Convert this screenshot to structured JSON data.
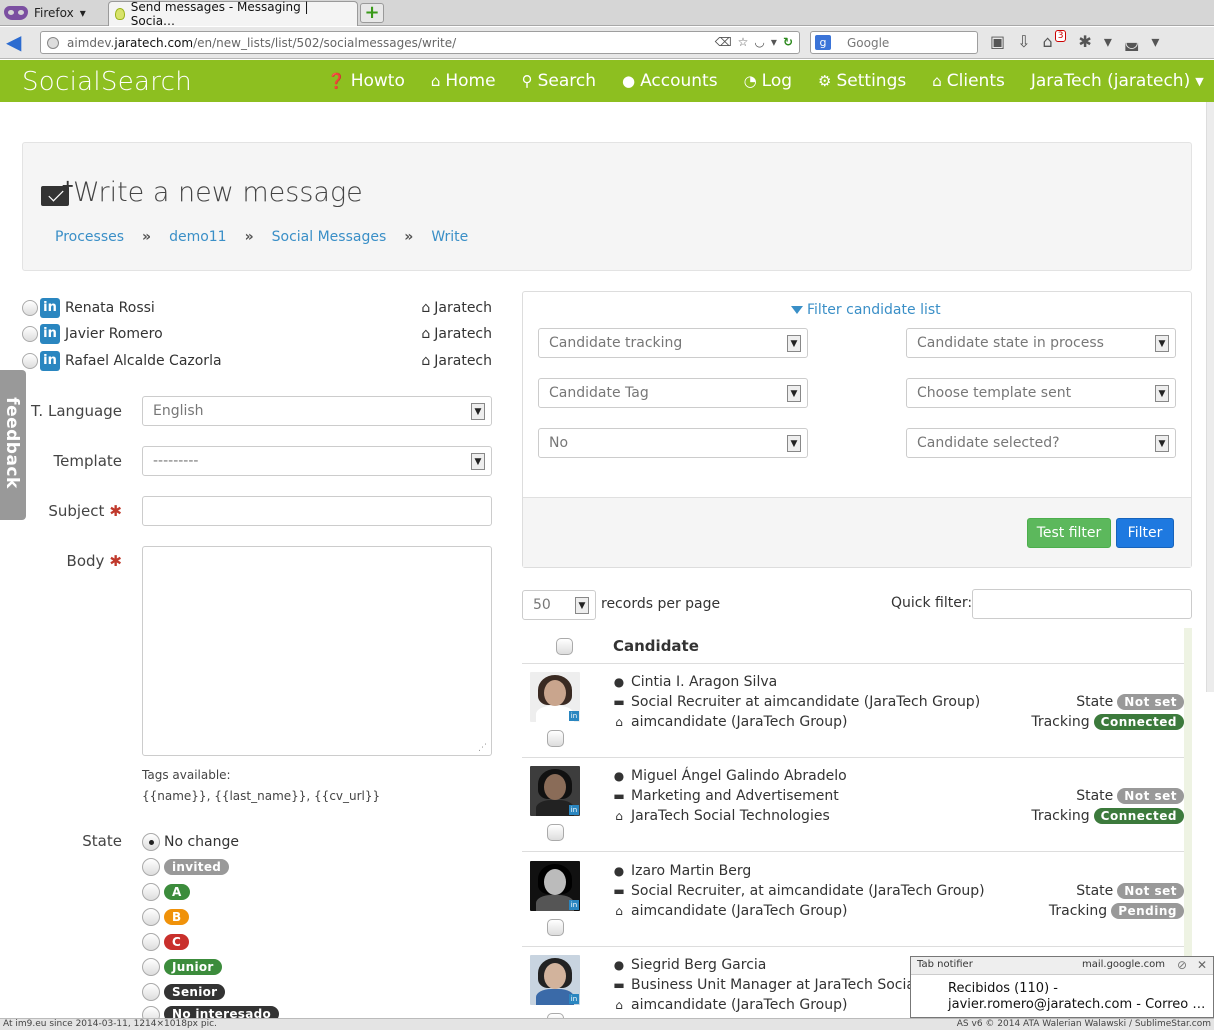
{
  "browser": {
    "menu_label": "Firefox",
    "tab_title": "Send messages - Messaging | Socia…",
    "url_prefix": "aimdev.",
    "url_domain": "jaratech.com",
    "url_path": "/en/new_lists/list/502/socialmessages/write/",
    "search_engine_letter": "g",
    "search_placeholder": "Google",
    "badge_count": "3"
  },
  "app": {
    "brand": "SocialSearch",
    "menu": [
      {
        "label": "Howto",
        "icon": "question-circle-icon",
        "glyph": "?"
      },
      {
        "label": "Home",
        "icon": "home-icon",
        "glyph": "⌂"
      },
      {
        "label": "Search",
        "icon": "search-icon",
        "glyph": "⚲"
      },
      {
        "label": "Accounts",
        "icon": "user-icon",
        "glyph": "👤"
      },
      {
        "label": "Log",
        "icon": "clock-check-icon",
        "glyph": "◔"
      },
      {
        "label": "Settings",
        "icon": "gear-icon",
        "glyph": "⚙"
      },
      {
        "label": "Clients",
        "icon": "institution-icon",
        "glyph": "🏛"
      }
    ],
    "user_menu": "JaraTech (jaratech)",
    "accent_color": "#8dbf20"
  },
  "heading": {
    "title": "Write a new message",
    "breadcrumb": [
      "Processes",
      "demo11",
      "Social Messages",
      "Write"
    ],
    "separator": "»"
  },
  "recipients": [
    {
      "name": "Renata Rossi",
      "org": "Jaratech"
    },
    {
      "name": "Javier Romero",
      "org": "Jaratech"
    },
    {
      "name": "Rafael Alcalde Cazorla",
      "org": "Jaratech"
    }
  ],
  "form": {
    "language_label": "T. Language",
    "language_value": "English",
    "template_label": "Template",
    "template_value": "---------",
    "subject_label": "Subject",
    "subject_value": "",
    "body_label": "Body",
    "body_value": "",
    "required_mark": "✱",
    "tags_label": "Tags available:",
    "tags_value": "{{name}}, {{last_name}}, {{cv_url}}",
    "state_label": "State",
    "state_options": [
      {
        "label": "No change",
        "type": "text",
        "selected": true
      },
      {
        "label": "invited",
        "type": "badge",
        "color": "#999999"
      },
      {
        "label": "A",
        "type": "badge",
        "color": "#3c8c3c"
      },
      {
        "label": "B",
        "type": "badge",
        "color": "#f0920a"
      },
      {
        "label": "C",
        "type": "badge",
        "color": "#c9302c"
      },
      {
        "label": "Junior",
        "type": "badge",
        "color": "#3c8c3c"
      },
      {
        "label": "Senior",
        "type": "badge",
        "color": "#333333"
      },
      {
        "label": "No interesado",
        "type": "badge",
        "color": "#333333"
      }
    ]
  },
  "filter": {
    "title": "Filter candidate list",
    "selects": [
      "Candidate tracking",
      "Candidate state in process",
      "Candidate Tag",
      "Choose template sent",
      "No",
      "Candidate selected?"
    ],
    "test_button": "Test filter",
    "filter_button": "Filter"
  },
  "table": {
    "per_page_value": "50",
    "per_page_label": "records per page",
    "quick_filter_label": "Quick filter:",
    "quick_filter_value": "",
    "column_header": "Candidate",
    "state_label": "State",
    "tracking_label": "Tracking",
    "rows": [
      {
        "name": "Cintia I. Aragon Silva",
        "title": "Social Recruiter at aimcandidate (JaraTech Group)",
        "company": "aimcandidate (JaraTech Group)",
        "state": "Not set",
        "tracking": "Connected"
      },
      {
        "name": "Miguel Ángel Galindo Abradelo",
        "title": "Marketing and Advertisement",
        "company": "JaraTech Social Technologies",
        "state": "Not set",
        "tracking": "Connected"
      },
      {
        "name": "Izaro Martin Berg",
        "title": "Social Recruiter, at aimcandidate (JaraTech Group)",
        "company": "aimcandidate (JaraTech Group)",
        "state": "Not set",
        "tracking": "Pending"
      },
      {
        "name": "Siegrid Berg Garcia",
        "title": "Business Unit Manager at JaraTech Social",
        "company": "aimcandidate (JaraTech Group)",
        "state": "",
        "tracking": ""
      }
    ],
    "status_colors": {
      "Not set": "#999999",
      "Connected": "#3c7a3c",
      "Pending": "#999999"
    }
  },
  "feedback_tab": "feedback",
  "notifier": {
    "header": "Tab notifier",
    "source": "mail.google.com",
    "line1": "Recibidos (110) -",
    "line2": "javier.romero@jaratech.com - Correo …"
  },
  "statusbar": {
    "left": "At im9.eu since 2014-03-11, 1214×1018px pic.",
    "right": "AS v6 © 2014 ATA Walerian Walawski / SublimeStar.com"
  }
}
